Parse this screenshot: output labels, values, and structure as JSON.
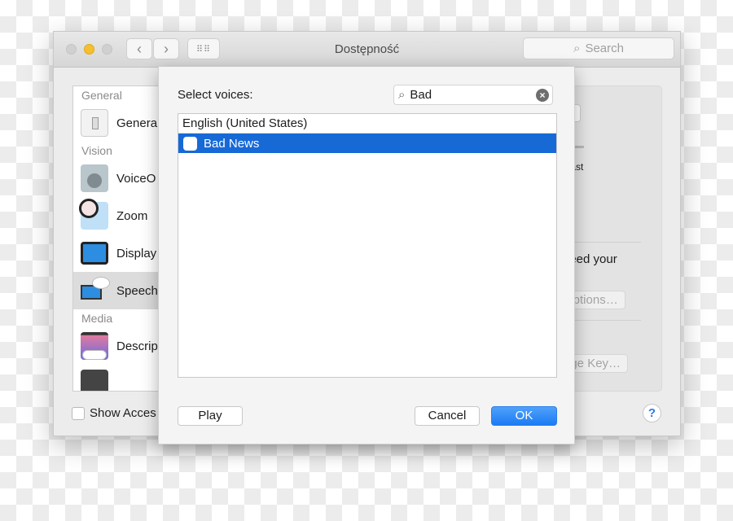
{
  "window": {
    "title": "Dostępność",
    "search_placeholder": "Search",
    "traffic_lights": {
      "close": "#d0d0d0",
      "minimize": "#f5bf2f",
      "zoom": "#d0d0d0"
    }
  },
  "sidebar": {
    "sections": [
      {
        "title": "General",
        "items": [
          {
            "label": "Genera",
            "icon": "switch-icon"
          }
        ]
      },
      {
        "title": "Vision",
        "items": [
          {
            "label": "VoiceO",
            "icon": "voiceover-icon"
          },
          {
            "label": "Zoom",
            "icon": "zoom-icon"
          },
          {
            "label": "Display",
            "icon": "display-icon"
          },
          {
            "label": "Speech",
            "icon": "speech-icon",
            "selected": true
          }
        ]
      },
      {
        "title": "Media",
        "items": [
          {
            "label": "Descrip",
            "icon": "descriptions-icon"
          }
        ]
      }
    ]
  },
  "right_panel": {
    "speed_label": "Fast",
    "text_fragment": "need your",
    "options_button": "Options…",
    "change_key_button": "nge Key…"
  },
  "footer": {
    "show_label": "Show Acces",
    "help": "?"
  },
  "sheet": {
    "label": "Select voices:",
    "search_value": "Bad",
    "group": "English (United States)",
    "voices": [
      {
        "label": "Bad News",
        "checked": false,
        "selected": true
      }
    ],
    "play_button": "Play",
    "cancel_button": "Cancel",
    "ok_button": "OK",
    "accent": "#1769d6"
  }
}
